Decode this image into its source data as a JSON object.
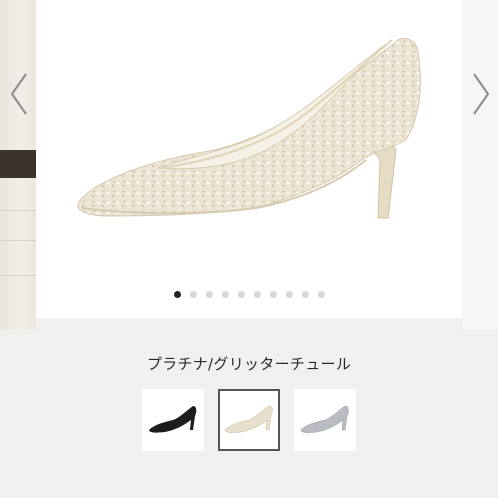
{
  "product": {
    "selected_color_label": "プラチナ/グリッターチュール"
  },
  "carousel": {
    "slide_count": 10,
    "active_index": 0
  },
  "swatches": [
    {
      "name": "black-glitter",
      "color": "#1c1c1e"
    },
    {
      "name": "platinum-glitter",
      "color": "#e8dfcc",
      "selected": true
    },
    {
      "name": "silver-glitter",
      "color": "#b9bcc2"
    }
  ],
  "colors": {
    "background": "#f2f0ee",
    "dot_active": "#222222",
    "dot_inactive": "#d8d8d8",
    "selected_border": "#555555"
  },
  "icons": {
    "prev": "chevron-left-icon",
    "next": "chevron-right-icon"
  }
}
